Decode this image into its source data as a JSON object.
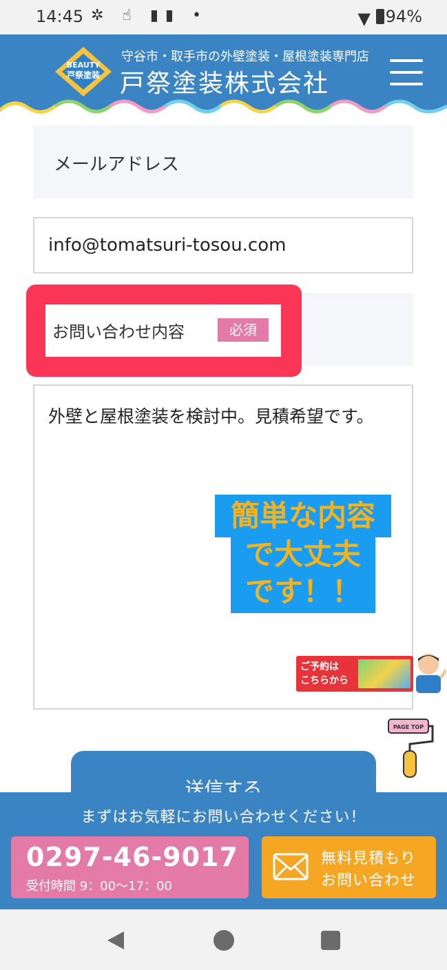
{
  "status_bar": {
    "time": "14:45",
    "battery": "94%"
  },
  "header": {
    "logo_text_top": "BEAUTY",
    "logo_text_main": "戸祭塗装",
    "tagline": "守谷市・取手市の外壁塗装・屋根塗装専門店",
    "company_name": "戸祭塗装株式会社"
  },
  "form": {
    "email_label": "メールアドレス",
    "email_value": "info@tomatsuri-tosou.com",
    "inquiry_label": "お問い合わせ内容",
    "required_badge": "必須",
    "inquiry_value": "外壁と屋根塗装を検討中。見積希望です。",
    "callout_line1": "簡単な内容",
    "callout_line2": "で大丈夫",
    "callout_line3": "です！！",
    "submit_label": "送信する"
  },
  "floating": {
    "reserve_line1": "ご予約は",
    "reserve_line2": "こちらから",
    "page_top": "PAGE TOP"
  },
  "cta": {
    "lead": "まずはお気軽にお問い合わせください！",
    "phone": "0297-46-9017",
    "hours": "受付時間 9：00〜17：00",
    "quote_line1": "無料見積もり",
    "quote_line2": "お問い合わせ"
  },
  "colors": {
    "header_blue": "#3a84c4",
    "highlight_red": "#fb3556",
    "badge_pink": "#e37aa8",
    "quote_orange": "#f5a623",
    "callout_blue": "#1a9cf0",
    "callout_text": "#f3b21f"
  }
}
